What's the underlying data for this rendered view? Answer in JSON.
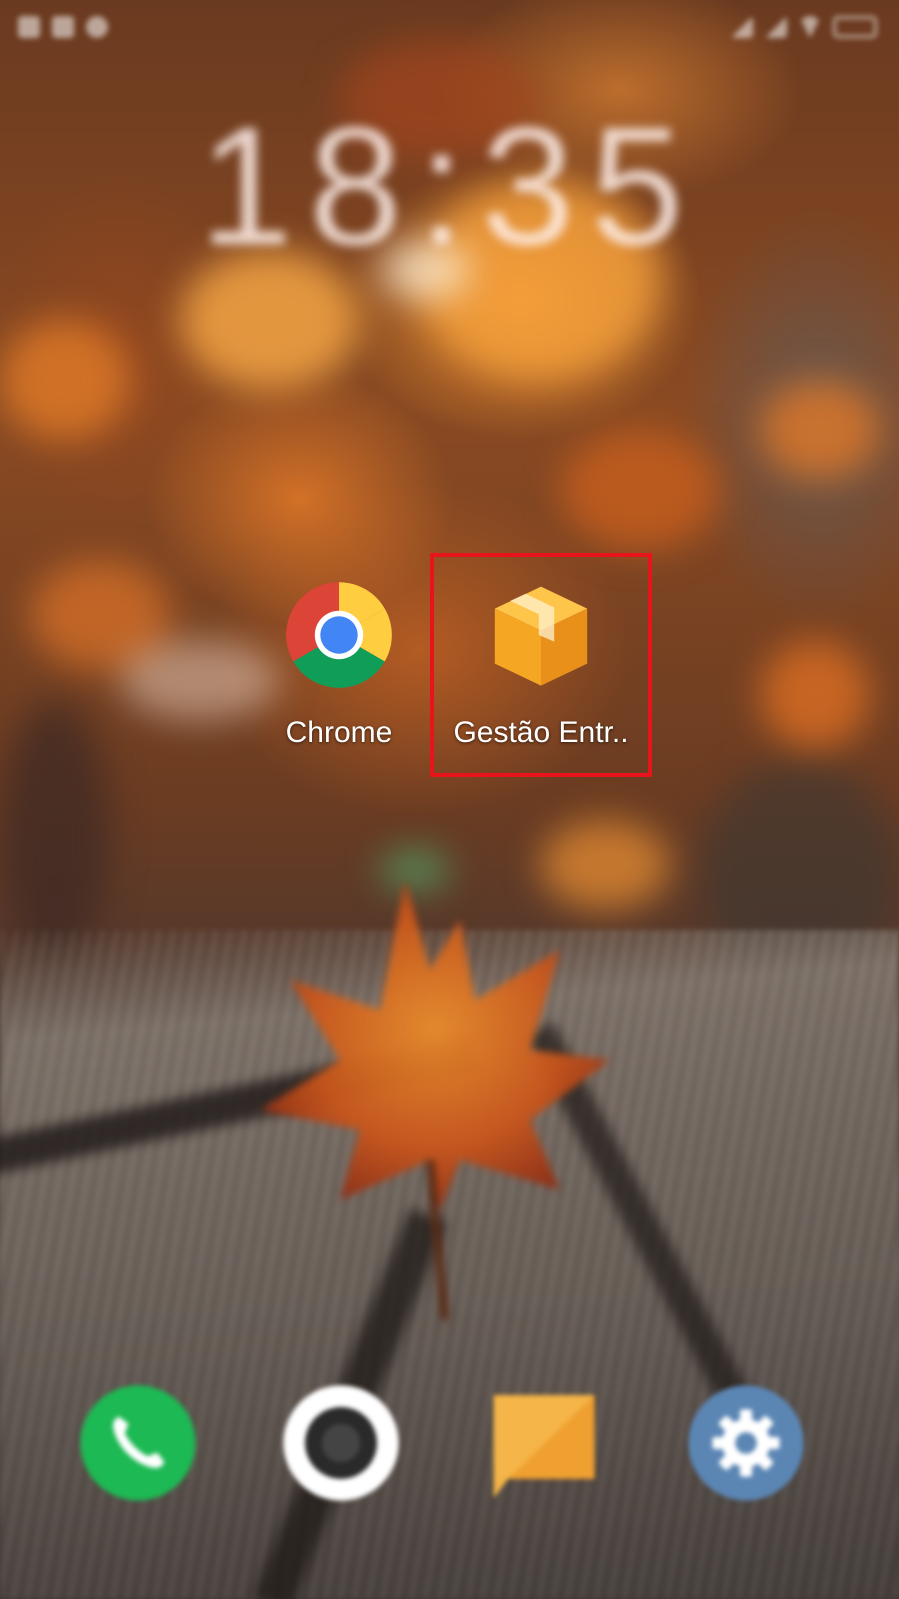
{
  "status_bar": {
    "icons_left": [
      "notification-icon",
      "notification-icon",
      "notification-icon"
    ],
    "icons_right": [
      "signal-icon",
      "signal-icon",
      "wifi-icon",
      "battery-icon"
    ]
  },
  "clock": {
    "time": "18:35"
  },
  "apps": [
    {
      "name": "chrome",
      "label": "Chrome",
      "icon": "chrome-icon"
    },
    {
      "name": "gestao-entregas",
      "label": "Gestão Entr..",
      "icon": "package-box-icon",
      "highlighted": true,
      "highlight_color": "#e8141c"
    }
  ],
  "dock": [
    {
      "name": "phone",
      "icon": "phone-icon",
      "color": "#1db954"
    },
    {
      "name": "camera",
      "icon": "camera-icon",
      "color": "#ffffff"
    },
    {
      "name": "messages",
      "icon": "message-icon",
      "color": "#f5b548"
    },
    {
      "name": "settings",
      "icon": "gear-icon",
      "color": "#5b86b4"
    }
  ]
}
